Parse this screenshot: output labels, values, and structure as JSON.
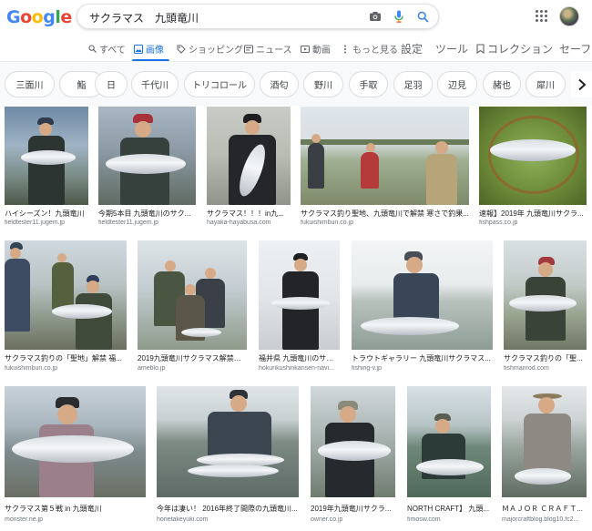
{
  "header": {
    "logo_letters": [
      "G",
      "o",
      "o",
      "g",
      "l",
      "e"
    ],
    "logo_colors": [
      "#4285f4",
      "#ea4335",
      "#fbbc05",
      "#4285f4",
      "#34a853",
      "#ea4335"
    ],
    "search_query": "サクラマス　九頭竜川",
    "icons": [
      "camera-icon",
      "mic-icon",
      "search-icon",
      "apps-icon"
    ]
  },
  "tabs": [
    {
      "label": "すべて",
      "icon": "search-icon",
      "active": false
    },
    {
      "label": "画像",
      "icon": "image-icon",
      "active": true
    },
    {
      "label": "ショッピング",
      "icon": "tag-icon",
      "active": false
    },
    {
      "label": "ニュース",
      "icon": "news-icon",
      "active": false
    },
    {
      "label": "動画",
      "icon": "video-icon",
      "active": false
    },
    {
      "label": "もっと見る",
      "icon": "more-icon",
      "active": false
    },
    {
      "label": "設定",
      "active": false
    },
    {
      "label": "ツール",
      "active": false
    },
    {
      "label": "コレクション",
      "icon": "bookmark-icon",
      "active": false
    },
    {
      "label": "セーフ",
      "active": false
    }
  ],
  "chips": [
    "三面川",
    "鮨",
    "日",
    "千代川",
    "トリコロール",
    "酒匂",
    "野川",
    "手取",
    "足羽",
    "辺見",
    "赭也",
    "犀川"
  ],
  "results": [
    {
      "caption": "ハイシーズン！九頭竜川",
      "domain": "fieldtester11.jugem.jp"
    },
    {
      "caption": "今期5本目 九頭竜川のサク...",
      "domain": "fieldtester11.jugem.jp"
    },
    {
      "caption": "サクラマス！！！in九...",
      "domain": "hayaka-hayabusa.com"
    },
    {
      "caption": "サクラマス釣り聖地、九頭竜川で解禁 寒さで釣果...",
      "domain": "fukuishimbun.co.jp"
    },
    {
      "caption": "速報】2019年 九頭竜川サクラ...",
      "domain": "fishpass.co.jp"
    },
    {
      "caption": "サクラマス釣りの「聖地」解禁 福...",
      "domain": "fukuishimbun.co.jp"
    },
    {
      "caption": "2019九頭竜川サクラマス解禁の...",
      "domain": "ameblo.jp"
    },
    {
      "caption": "福井県 九頭竜川のサクラ...",
      "domain": "hokurikushinkansen-navi..."
    },
    {
      "caption": "トラウトギャラリー 九頭竜川サクラマス...",
      "domain": "fishing-v.jp"
    },
    {
      "caption": "サクラマス釣りの「聖...",
      "domain": "fishmanrod.com"
    },
    {
      "caption": "サクラマス第５戦 in 九頭竜川",
      "domain": "monster.ne.jp"
    },
    {
      "caption": "今年は凄い！ 2016年終了間際の九頭竜川...",
      "domain": "horietakeyuki.com"
    },
    {
      "caption": "2019年九頭竜川サクラ...",
      "domain": "owner.co.jp"
    },
    {
      "caption": "NORTH CRAFT】 九頭...",
      "domain": "fimosw.com"
    },
    {
      "caption": "ＭＡＪＯＲ ＣＲＡＦＴ...",
      "domain": "majorcraftblog.blog10.fc2..."
    }
  ],
  "colors": {
    "accent": "#1a73e8",
    "text": "#202124",
    "muted": "#70757a",
    "chip_border": "#dadce0"
  }
}
